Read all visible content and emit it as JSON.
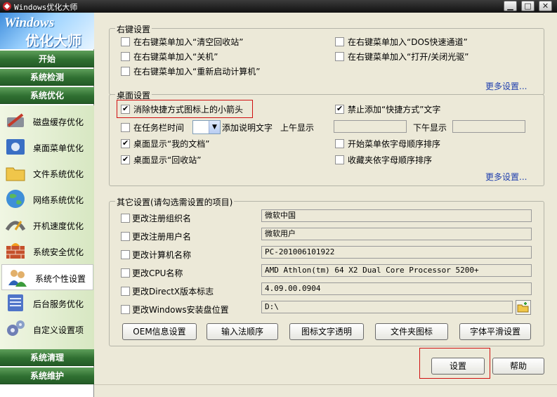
{
  "window": {
    "title": "Windows优化大师",
    "min": "▁",
    "max": "□",
    "close": "✕"
  },
  "sidebar": {
    "logo_line1": "Windows",
    "logo_line2": "优化大师",
    "sections_top": [
      "开始",
      "系统检测",
      "系统优化"
    ],
    "items": [
      {
        "label": "磁盘缓存优化",
        "icon": "disk-cache-icon"
      },
      {
        "label": "桌面菜单优化",
        "icon": "desktop-menu-icon"
      },
      {
        "label": "文件系统优化",
        "icon": "file-system-icon"
      },
      {
        "label": "网络系统优化",
        "icon": "network-globe-icon"
      },
      {
        "label": "开机速度优化",
        "icon": "boot-speed-icon"
      },
      {
        "label": "系统安全优化",
        "icon": "security-wall-icon"
      },
      {
        "label": "系统个性设置",
        "icon": "personalize-users-icon"
      },
      {
        "label": "后台服务优化",
        "icon": "background-service-icon"
      },
      {
        "label": "自定义设置项",
        "icon": "custom-gears-icon"
      }
    ],
    "selected_index": 6,
    "sections_bottom": [
      "系统清理",
      "系统维护"
    ]
  },
  "right_click": {
    "title": "右键设置",
    "opts": [
      "在右键菜单加入“清空回收站”",
      "在右键菜单加入“关机”",
      "在右键菜单加入“重新启动计算机”",
      "在右键菜单加入“DOS快速通道”",
      "在右键菜单加入“打开/关闭光驱”"
    ],
    "more": "更多设置..."
  },
  "desktop": {
    "title": "桌面设置",
    "remove_arrow": "消除快捷方式图标上的小箭头",
    "no_shortcut_text": "禁止添加“快捷方式”文字",
    "taskbar_time": "在任务栏时间",
    "add_desc": "添加说明文字",
    "am_label": "上午显示",
    "pm_label": "下午显示",
    "my_docs": "桌面显示“我的文档”",
    "recycle": "桌面显示“回收站”",
    "start_sort": "开始菜单依字母顺序排序",
    "fav_sort": "收藏夹依字母顺序排序",
    "more": "更多设置..."
  },
  "other": {
    "title": "其它设置(请勾选需设置的项目)",
    "rows": [
      {
        "label": "更改注册组织名",
        "value": "微软中国"
      },
      {
        "label": "更改注册用户名",
        "value": "微软用户"
      },
      {
        "label": "更改计算机名称",
        "value": "PC-201006101922"
      },
      {
        "label": "更改CPU名称",
        "value": "AMD Athlon(tm) 64 X2 Dual Core Processor 5200+"
      },
      {
        "label": "更改DirectX版本标志",
        "value": "4.09.00.0904"
      },
      {
        "label": "更改Windows安装盘位置",
        "value": "D:\\"
      }
    ],
    "buttons": [
      "OEM信息设置",
      "输入法顺序",
      "图标文字透明",
      "文件夹图标",
      "字体平滑设置"
    ]
  },
  "footer": {
    "set": "设置",
    "help": "帮助"
  }
}
